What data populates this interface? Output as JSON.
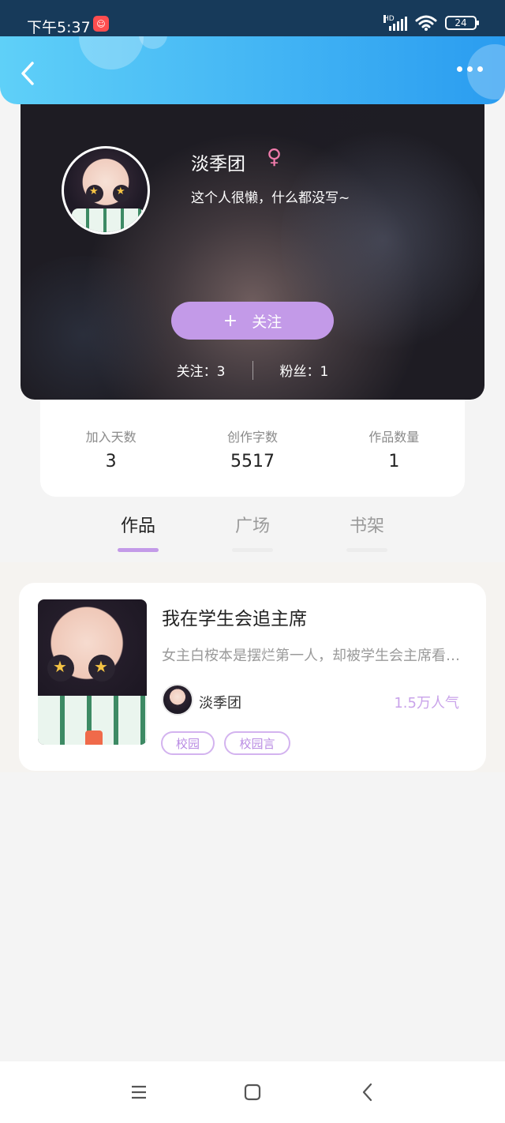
{
  "status_bar": {
    "time": "下午5:37",
    "network": "HD",
    "battery": "24"
  },
  "profile": {
    "name": "淡季团",
    "gender_symbol": "♀",
    "bio": "这个人很懒，什么都没写~",
    "follow_button": "关注",
    "following_label": "关注：3",
    "followers_label": "粉丝：1"
  },
  "stats": [
    {
      "label": "加入天数",
      "value": "3"
    },
    {
      "label": "创作字数",
      "value": "5517"
    },
    {
      "label": "作品数量",
      "value": "1"
    }
  ],
  "tabs": [
    {
      "label": "作品",
      "active": true
    },
    {
      "label": "广场",
      "active": false
    },
    {
      "label": "书架",
      "active": false
    }
  ],
  "works": [
    {
      "title": "我在学生会追主席",
      "description": "女主白桉本是摆烂第一人，却被学生会主席看中…",
      "author": "淡季团",
      "popularity": "1.5万人气",
      "tags": [
        "校园",
        "校园言"
      ]
    }
  ],
  "colors": {
    "accent": "#c39ae8",
    "header_gradient_start": "#5fd0f8",
    "header_gradient_end": "#2a9cf0",
    "gender": "#f07bab"
  },
  "icons": {
    "back": "chevron-left-icon",
    "more": "more-dots-icon",
    "nav_menu": "menu-icon",
    "nav_home": "home-square-icon",
    "nav_back": "nav-back-icon"
  }
}
